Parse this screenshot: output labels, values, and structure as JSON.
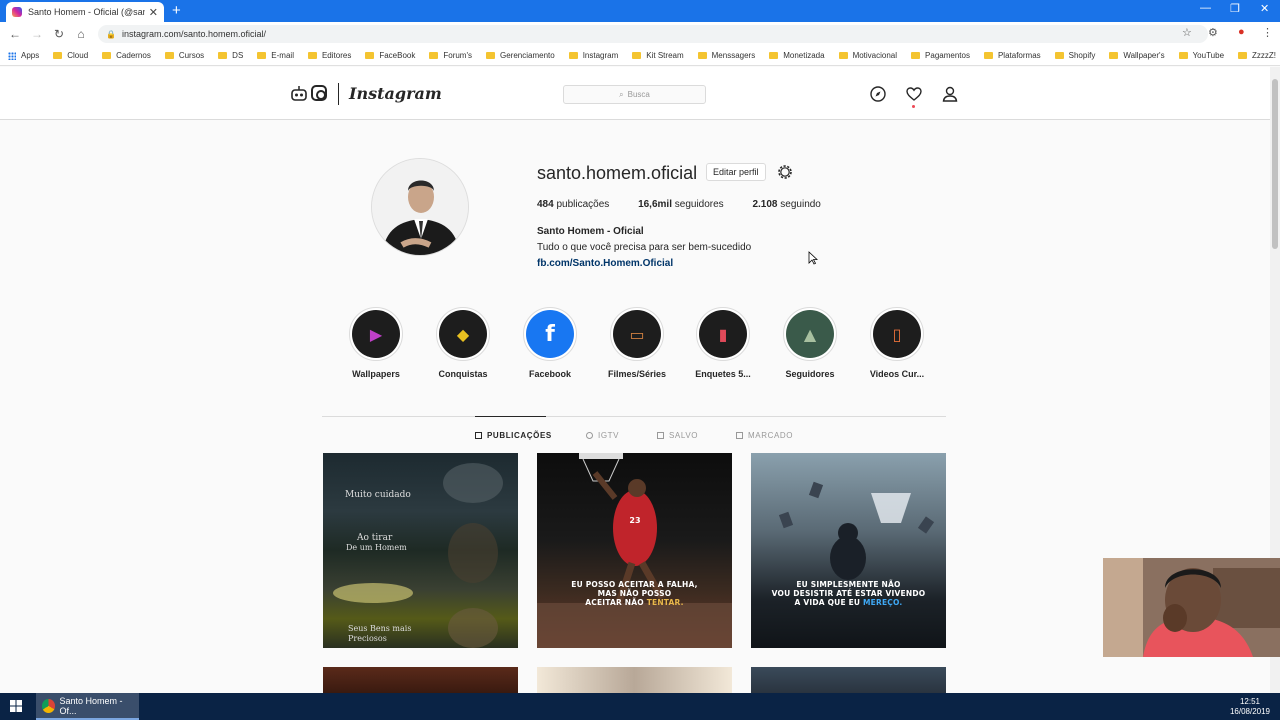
{
  "browser": {
    "tab_title": "Santo Homem - Oficial (@santo.h",
    "url": "instagram.com/santo.homem.oficial/",
    "bookmarks": [
      "Apps",
      "Cloud",
      "Cadernos",
      "Cursos",
      "DS",
      "E-mail",
      "Editores",
      "FaceBook",
      "Forum's",
      "Gerenciamento",
      "Instagram",
      "Kit Stream",
      "Menssagers",
      "Monetizada",
      "Motivacional",
      "Pagamentos",
      "Plataformas",
      "Shopify",
      "Wallpaper's",
      "YouTube",
      "ZzzzZ!"
    ]
  },
  "header": {
    "wordmark": "Instagram",
    "search_placeholder": "Busca"
  },
  "profile": {
    "username": "santo.homem.oficial",
    "edit_label": "Editar perfil",
    "posts_count": "484",
    "posts_label": "publicações",
    "followers_count": "16,6mil",
    "followers_label": "seguidores",
    "following_count": "2.108",
    "following_label": "seguindo",
    "full_name": "Santo Homem - Oficial",
    "bio": "Tudo o que você precisa para ser bem-sucedido",
    "link": "fb.com/Santo.Homem.Oficial"
  },
  "highlights": [
    {
      "label": "Wallpapers",
      "icon": "play-circle-icon"
    },
    {
      "label": "Conquistas",
      "icon": "medal-icon"
    },
    {
      "label": "Facebook",
      "icon": "facebook-icon"
    },
    {
      "label": "Filmes/Séries",
      "icon": "monitor-icon"
    },
    {
      "label": "Enquetes 5...",
      "icon": "poll-icon"
    },
    {
      "label": "Seguidores",
      "icon": "landscape-icon"
    },
    {
      "label": "Videos Cur...",
      "icon": "phone-icon"
    }
  ],
  "post_tabs": [
    "PUBLICAÇÕES",
    "IGTV",
    "SALVO",
    "MARCADO"
  ],
  "posts": {
    "p1_lines": [
      "Muito cuidado",
      "Ao tirar",
      "De um Homem",
      "Seus Bens mais",
      "Preciosos"
    ],
    "p2_caption_a": "EU POSSO ACEITAR A FALHA,",
    "p2_caption_b": "MAS NÃO POSSO",
    "p2_caption_c": "ACEITAR NÃO ",
    "p2_caption_hl": "TENTAR.",
    "p3_caption_a": "EU SIMPLESMENTE NÃO",
    "p3_caption_b": "VOU DESISTIR ATÉ ESTAR VIVENDO",
    "p3_caption_c": "A VIDA QUE EU ",
    "p3_caption_hl": "MEREÇO."
  },
  "taskbar": {
    "task_label": "Santo Homem - Of...",
    "time": "12:51",
    "date": "16/08/2019"
  },
  "colors": {
    "chrome_blue": "#1a73e8",
    "link_blue": "#003569",
    "notification_red": "#ed4956"
  }
}
